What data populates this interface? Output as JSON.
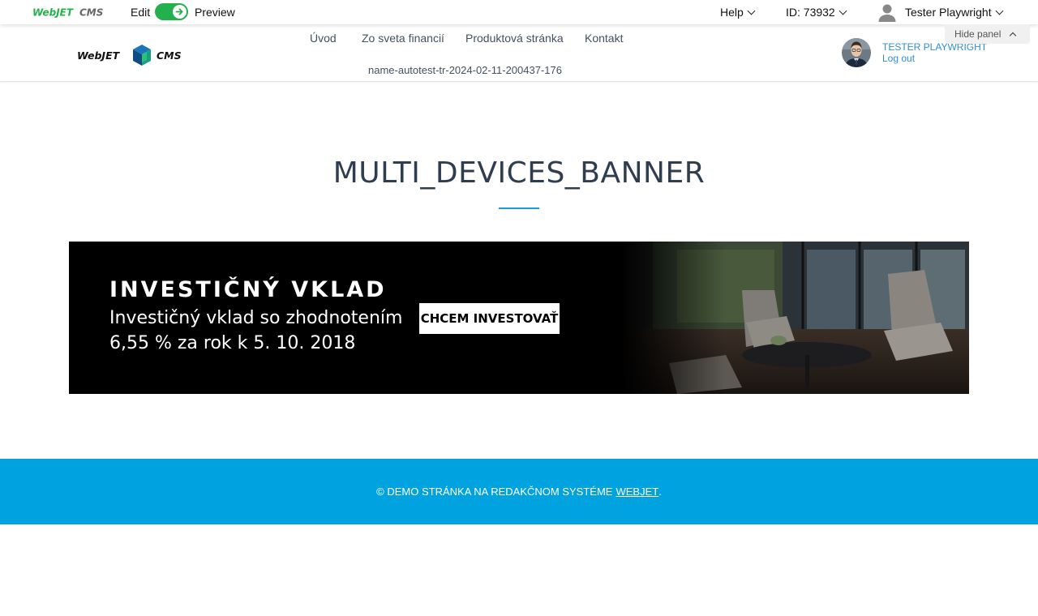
{
  "admin_bar": {
    "logo_text": "WebJETCMS",
    "edit_label": "Edit",
    "preview_label": "Preview",
    "help_label": "Help",
    "id_label": "ID: 73932",
    "user_label": "Tester Playwright",
    "accent_color": "#22b14c"
  },
  "header": {
    "logo_text_left": "WebJET",
    "logo_text_right": "CMS",
    "nav": [
      {
        "label": "Úvod"
      },
      {
        "label": "Zo sveta financií"
      },
      {
        "label": "Produktová stránka"
      },
      {
        "label": "Kontakt"
      },
      {
        "label": "name-autotest-tr-2024-02-11-200437-176"
      }
    ],
    "profile_name": "TESTER PLAYWRIGHT",
    "logout_label": "Log out",
    "hide_panel_label": "Hide panel"
  },
  "main": {
    "title": "MULTI_DEVICES_BANNER",
    "accent_color": "#1a9be0"
  },
  "banner": {
    "heading": "INVESTIČNÝ VKLAD",
    "line1": "Investičný vklad so zhodnotením",
    "line2": "6,55 % za rok k 5. 10. 2018",
    "cta_label": "CHCEM INVESTOVAŤ"
  },
  "footer": {
    "text": "© DEMO STRÁNKA NA REDAKČNOM SYSTÉME",
    "link_label": "WEBJET",
    "trailing": ".",
    "color": "#00a3e0"
  }
}
